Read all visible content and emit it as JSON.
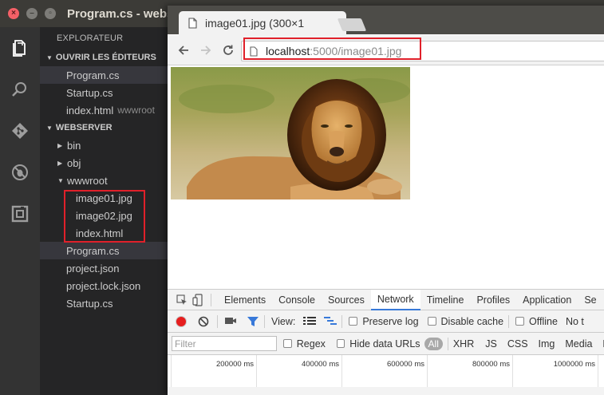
{
  "vscode": {
    "title": "Program.cs - webse",
    "explorer_title": "EXPLORATEUR",
    "open_editors_header": "OUVRIR LES ÉDITEURS",
    "open_editors": [
      {
        "name": "Program.cs",
        "desc": ""
      },
      {
        "name": "Startup.cs",
        "desc": ""
      },
      {
        "name": "index.html",
        "desc": "wwwroot"
      }
    ],
    "project_header": "WEBSERVER",
    "tree": {
      "bin": "bin",
      "obj": "obj",
      "wwwroot": "wwwroot",
      "wwwroot_children": [
        "image01.jpg",
        "image02.jpg",
        "index.html"
      ],
      "files": [
        "Program.cs",
        "project.json",
        "project.lock.json",
        "Startup.cs"
      ]
    }
  },
  "chrome": {
    "tab_title": "image01.jpg (300×1",
    "url_host": "localhost",
    "url_rest": ":5000/image01.jpg",
    "devtools": {
      "tabs": [
        "Elements",
        "Console",
        "Sources",
        "Network",
        "Timeline",
        "Profiles",
        "Application",
        "Se"
      ],
      "active_tab": "Network",
      "view_label": "View:",
      "preserve_log": "Preserve log",
      "disable_cache": "Disable cache",
      "offline": "Offline",
      "throttle": "No t",
      "filter_placeholder": "Filter",
      "regex": "Regex",
      "hide_data_urls": "Hide data URLs",
      "types": [
        "All",
        "XHR",
        "JS",
        "CSS",
        "Img",
        "Media",
        "Fo"
      ],
      "timeline_ticks": [
        "200000 ms",
        "400000 ms",
        "600000 ms",
        "800000 ms",
        "1000000 ms"
      ]
    }
  },
  "colors": {
    "highlight": "#e0202a",
    "accent": "#3879d9",
    "record": "#e61e1e"
  }
}
